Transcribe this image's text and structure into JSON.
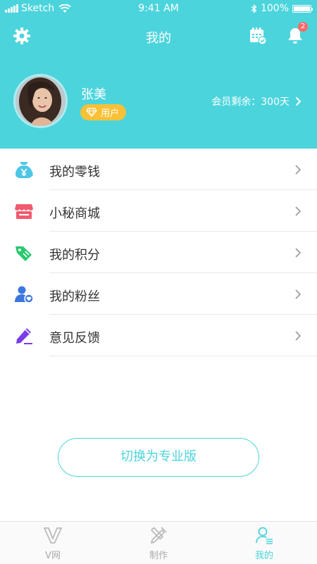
{
  "status_bar": {
    "carrier": "Sketch",
    "time": "9:41 AM",
    "battery": "100%",
    "battery_level": 1.0
  },
  "navbar": {
    "title": "我的",
    "settings_icon": "gear-icon",
    "calendar_icon": "calendar-check-icon",
    "notification_icon": "bell-icon",
    "notification_count": "2"
  },
  "profile": {
    "name": "张美",
    "role": "用户",
    "role_icon": "diamond-icon",
    "membership": "会员剩余：300天"
  },
  "menu": {
    "items": [
      {
        "label": "我的零钱",
        "icon": "money-bag-icon",
        "color": "#4cc6e6"
      },
      {
        "label": "小秘商城",
        "icon": "store-icon",
        "color": "#f25a6e"
      },
      {
        "label": "我的积分",
        "icon": "tag-icon",
        "color": "#28c86e"
      },
      {
        "label": "我的粉丝",
        "icon": "fans-icon",
        "color": "#3a78e0"
      },
      {
        "label": "意见反馈",
        "icon": "pencil-icon",
        "color": "#7a3de8"
      }
    ]
  },
  "switch_button": {
    "label": "切换为专业版"
  },
  "tabbar": {
    "tabs": [
      {
        "label": "V网",
        "icon": "v-logo-icon",
        "active": false
      },
      {
        "label": "制作",
        "icon": "tools-icon",
        "active": false
      },
      {
        "label": "我的",
        "icon": "user-icon",
        "active": true
      }
    ]
  },
  "colors": {
    "accent": "#4cd4dc",
    "badge": "#f8c138",
    "notification": "#ff6a6a"
  }
}
